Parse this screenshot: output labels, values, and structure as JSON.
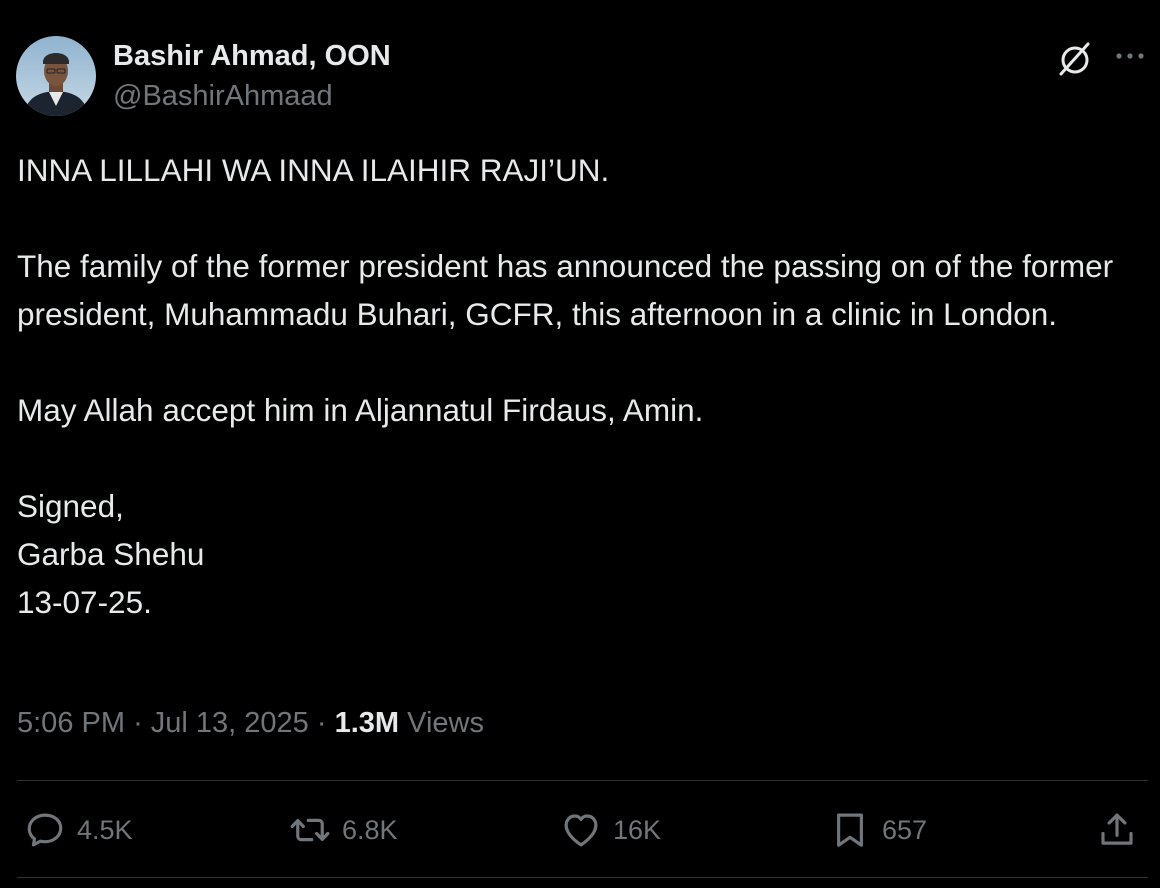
{
  "author": {
    "display_name": "Bashir Ahmad, OON",
    "handle": "@BashirAhmaad",
    "avatar_icon": "avatar-photo"
  },
  "header_icons": {
    "grok": "grok-icon",
    "more": "more-icon"
  },
  "tweet": {
    "paragraphs": [
      "INNA LILLAHI WA INNA ILAIHIR RAJI’UN.",
      "The family of the former president has announced the passing on of the former president, Muhammadu Buhari, GCFR, this afternoon in a clinic in London.",
      "May Allah accept him in Aljannatul Firdaus, Amin.",
      "Signed,\nGarba Shehu\n13-07-25."
    ]
  },
  "meta": {
    "time": "5:06 PM",
    "separator": "·",
    "date": "Jul 13, 2025",
    "views_count": "1.3M",
    "views_label": "Views"
  },
  "actions": {
    "replies": "4.5K",
    "reposts": "6.8K",
    "likes": "16K",
    "bookmarks": "657"
  },
  "colors": {
    "background": "#000000",
    "text_primary": "#e7e9ea",
    "text_secondary": "#71767b",
    "divider": "#2f3336"
  }
}
